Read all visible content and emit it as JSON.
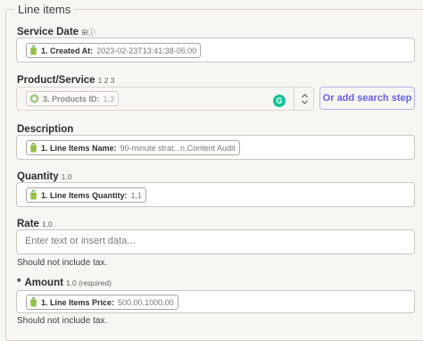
{
  "section": {
    "title": "Line items"
  },
  "service_date": {
    "label": "Service Date",
    "meta": "⊞ⓘ",
    "pill": {
      "label": "1. Created At:",
      "value": "2023-02-23T13:41:38-05:00"
    }
  },
  "product_service": {
    "label": "Product/Service",
    "meta": "1 2 3",
    "pill": {
      "label": "3. Products ID:",
      "value": "1,3"
    },
    "grammarly": "G",
    "search_step_button": "Or add search step"
  },
  "description": {
    "label": "Description",
    "pill": {
      "label": "1. Line Items Name:",
      "value": "90-minute strat...n,Content Audit"
    }
  },
  "quantity": {
    "label": "Quantity",
    "meta": "1.0",
    "pill": {
      "label": "1. Line Items Quantity:",
      "value": "1,1"
    }
  },
  "rate": {
    "label": "Rate",
    "meta": "1.0",
    "placeholder": "Enter text or insert data...",
    "help": "Should not include tax."
  },
  "amount": {
    "required_mark": "*",
    "label": "Amount",
    "meta": "1.0 (required)",
    "pill": {
      "label": "1. Line Items Price:",
      "value": "500.00,1000.00"
    },
    "help": "Should not include tax."
  },
  "colors": {
    "shopify_green": "#95bf47",
    "accent": "#6560e8",
    "grammarly": "#15c39a"
  },
  "icons": {
    "app": "shopify-bag-icon",
    "stepper": "chevron-up-down-icon"
  }
}
